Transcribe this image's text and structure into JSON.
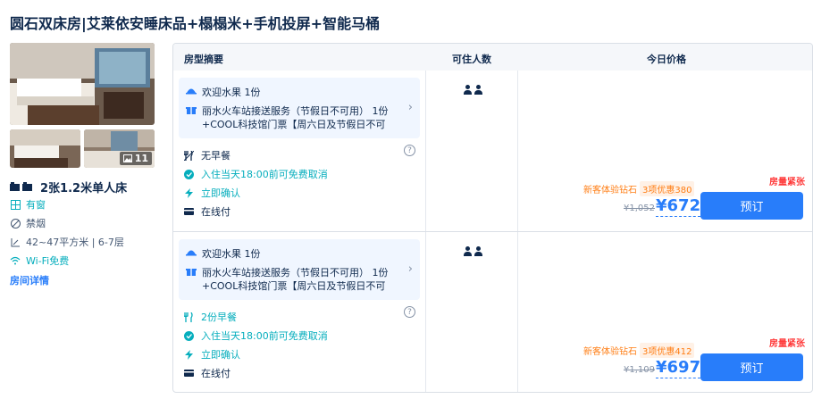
{
  "room": {
    "title": "圆石双床房|艾莱依安睡床品+榻榻米+手机投屏+智能马桶",
    "photo_count": "11",
    "bed": "2张1.2米单人床",
    "facilities": [
      "有窗",
      "禁烟",
      "42~47平方米 | 6-7层",
      "Wi-Fi免费"
    ],
    "detail_link": "房间详情"
  },
  "table": {
    "headers": {
      "name": "房型摘要",
      "guests": "可住人数",
      "price": "今日价格"
    },
    "rows": [
      {
        "perks": [
          "欢迎水果 1份",
          "丽水火车站接送服务（节假日不可用） 1份 +COOL科技馆门票【周六日及节假日不可用】..."
        ],
        "meal": "无早餐",
        "cancel": "入住当天18:00前可免费取消",
        "confirm": "立即确认",
        "payment": "在线付",
        "scarcity": "房量紧张",
        "promo_tag": "新客体验钻石",
        "promo_discount": "3项优惠380",
        "original_price": "¥1,052",
        "price": "¥672",
        "book_label": "预订"
      },
      {
        "perks": [
          "欢迎水果 1份",
          "丽水火车站接送服务（节假日不可用） 1份 +COOL科技馆门票【周六日及节假日不可用】..."
        ],
        "meal": "2份早餐",
        "cancel": "入住当天18:00前可免费取消",
        "confirm": "立即确认",
        "payment": "在线付",
        "scarcity": "房量紧张",
        "promo_tag": "新客体验钻石",
        "promo_discount": "3项优惠412",
        "original_price": "¥1,109",
        "price": "¥697",
        "book_label": "预订"
      }
    ]
  },
  "colors": {
    "brand": "#287dfa",
    "green": "#06aebd",
    "warning": "#ff3a3a",
    "promo": "#ff7d13"
  }
}
